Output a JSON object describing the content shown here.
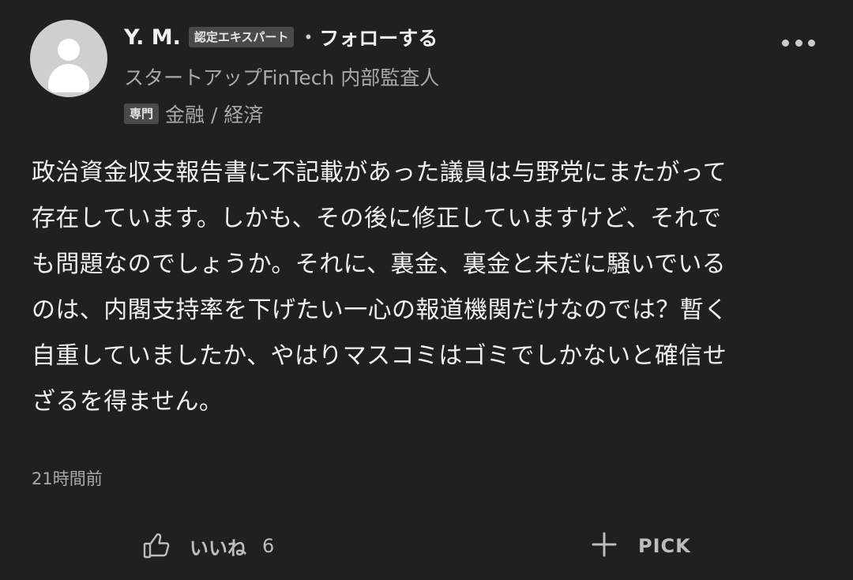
{
  "author": {
    "name": "Y. M.",
    "badge": "認定エキスパート",
    "separator": "•",
    "follow_label": "フォローする",
    "title": "スタートアップFinTech 内部監査人",
    "field_tag": "専門",
    "field": "金融 / 経済"
  },
  "comment": {
    "lines": [
      "政治資金収支報告書に不記載があった議員は与野党にまたがって",
      "存在しています。しかも、その後に修正していますけど、それで",
      "も問題なのでしょうか。それに、裏金、裏金と未だに騒いでいる",
      "のは、内閣支持率を下げたい一心の報道機関だけなのでは？暫く",
      "自重していましたか、やはりマスコミはゴミでしかないと確信せ",
      "ざるを得ません。"
    ],
    "time": "21時間前"
  },
  "actions": {
    "like_label": "いいね",
    "like_count": "6",
    "pick_label": "PICK"
  },
  "icons": {
    "avatar": "default-user-avatar",
    "more": "more-horizontal-icon",
    "like": "thumbs-up-icon",
    "pick": "plus-icon"
  }
}
